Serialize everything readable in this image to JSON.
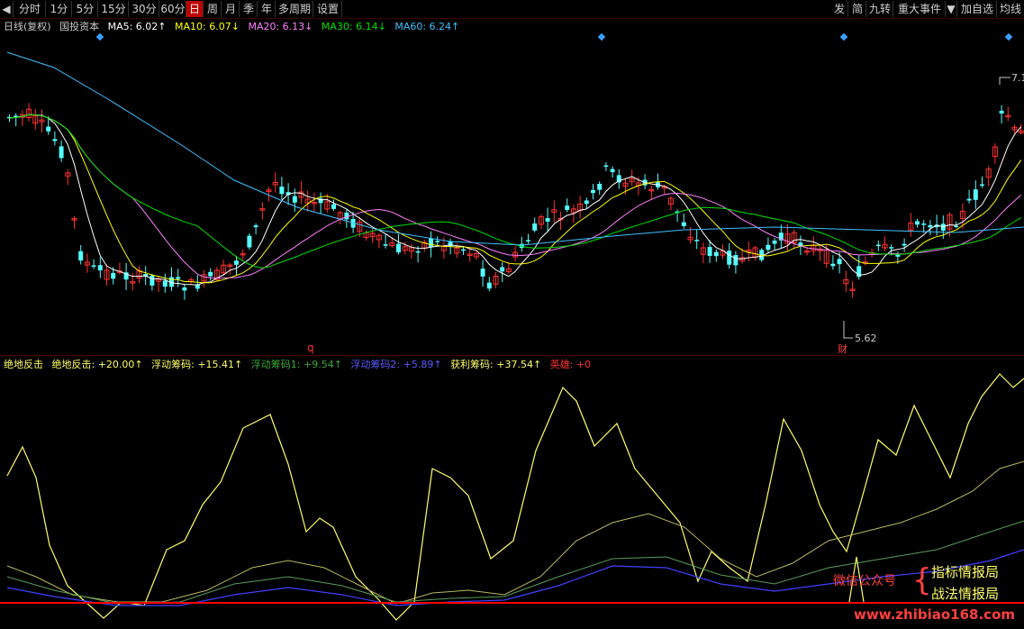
{
  "toolbar": {
    "left": [
      "分时",
      "1分",
      "5分",
      "15分",
      "30分",
      "60分",
      "日",
      "周",
      "月",
      "季",
      "年",
      "多周期",
      "设置"
    ],
    "right": [
      "发",
      "简",
      "九转",
      "重大事件",
      "加自选",
      "均线"
    ],
    "active": "日"
  },
  "main_legend": {
    "period": "日线(复权)",
    "name": "国投资本",
    "ma5": "MA5: 6.02↑",
    "ma10": "MA10: 6.07↓",
    "ma20": "MA20: 6.13↓",
    "ma30": "MA30: 6.14↓",
    "ma60": "MA60: 6.24↑"
  },
  "sub_legend": {
    "title": "绝地反击",
    "jdfj": "绝地反击: +20.00↑",
    "fdcm": "浮动筹码: +15.41↑",
    "fdcm1": "浮动筹码1: +9.54↑",
    "fdcm2": "浮动筹码2: +5.89↑",
    "hlcm": "获利筹码: +37.54↑",
    "yx": "英雄: +0"
  },
  "annotations": {
    "high_price": "7.1",
    "low_price": "5.62",
    "cai_marker": "财",
    "q_marker": "q"
  },
  "watermark": {
    "wechat": "微信公众号",
    "brand1": "指标情报局",
    "brand2": "战法情报局",
    "url": "www.zhibiao168.com"
  },
  "colors": {
    "up": "#ff3232",
    "down": "#54ffff",
    "ma5": "#ffffff",
    "ma10": "#ffff00",
    "ma20": "#ff80ff",
    "ma30": "#00e000",
    "ma60": "#40c0ff",
    "yellow_line": "#ffff66",
    "green_line": "#5a9a5a",
    "blue_line": "#4040ff",
    "baseline": "#ff0000"
  }
}
